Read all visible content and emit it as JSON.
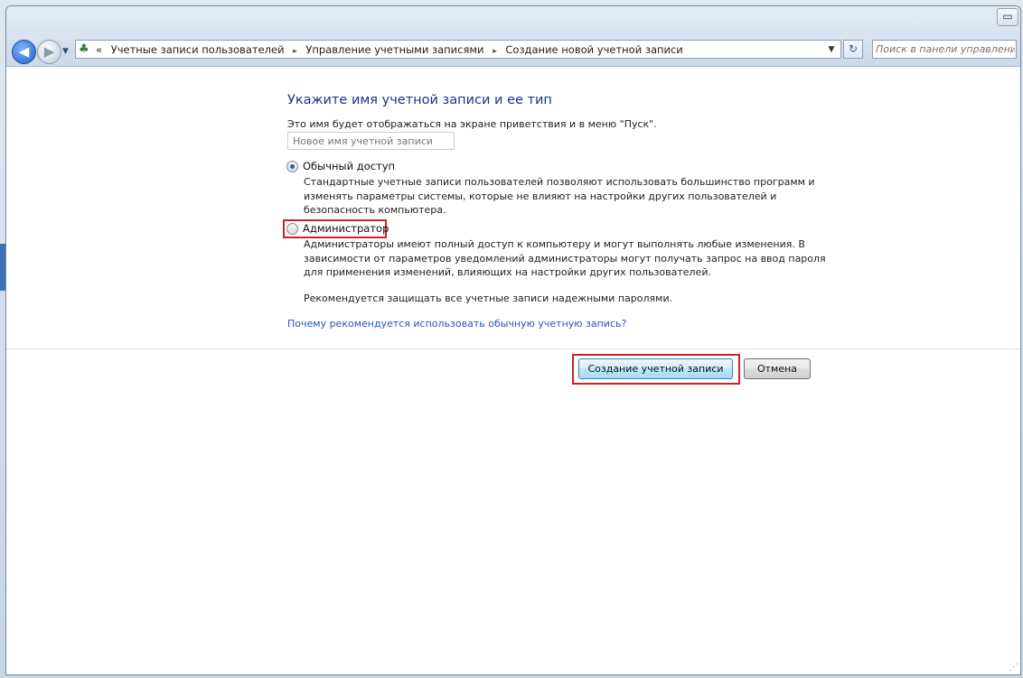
{
  "window": {
    "control_glyph": "▭"
  },
  "nav": {
    "back_glyph": "◀",
    "forward_glyph": "▶",
    "dropdown_glyph": "▼"
  },
  "address": {
    "icon_glyph": "♣",
    "prefix": "«",
    "separator": "▸",
    "crumbs": [
      "Учетные записи пользователей",
      "Управление учетными записями",
      "Создание новой учетной записи"
    ],
    "dropdown_glyph": "▼",
    "refresh_glyph": "↻"
  },
  "search": {
    "placeholder": "Поиск в панели управления"
  },
  "form": {
    "heading": "Укажите имя учетной записи и ее тип",
    "subtext": "Это имя будет отображаться на экране приветствия и в меню \"Пуск\".",
    "name_placeholder": "Новое имя учетной записи",
    "options": [
      {
        "label": "Обычный доступ",
        "selected": true,
        "description": "Стандартные учетные записи пользователей позволяют использовать большинство программ и изменять параметры системы, которые не влияют на настройки других пользователей и безопасность компьютера."
      },
      {
        "label": "Администратор",
        "selected": false,
        "description": "Администраторы имеют полный доступ к компьютеру и могут выполнять любые изменения. В зависимости от параметров уведомлений администраторы могут получать запрос на ввод пароля для применения изменений, влияющих на настройки других пользователей."
      }
    ],
    "recommendation": "Рекомендуется защищать все учетные записи надежными паролями.",
    "help_link": "Почему рекомендуется использовать обычную учетную запись?"
  },
  "buttons": {
    "create": "Создание учетной записи",
    "cancel": "Отмена"
  },
  "colors": {
    "highlight": "#d02025",
    "heading": "#1e3287",
    "link": "#1f5bb5"
  },
  "icons": [
    "back-arrow-icon",
    "forward-arrow-icon",
    "user-accounts-icon",
    "refresh-icon",
    "radio-selected-icon"
  ]
}
